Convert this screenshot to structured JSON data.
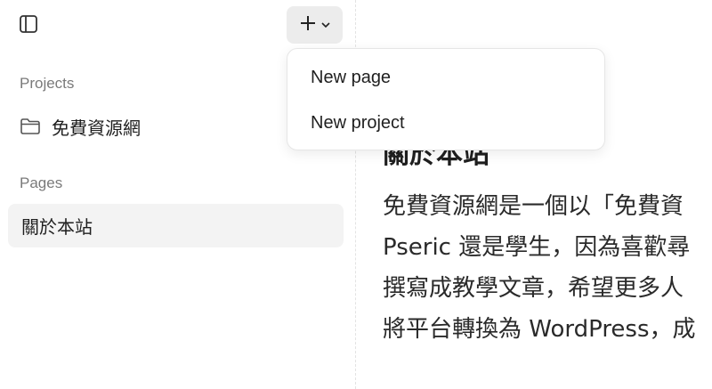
{
  "sidebar": {
    "toggle_icon": "sidebar-toggle-icon",
    "add_icon": "plus-icon",
    "add_chevron_icon": "chevron-down-icon",
    "projects_label": "Projects",
    "projects": [
      {
        "label": "免費資源網",
        "icon": "folder-icon"
      }
    ],
    "pages_label": "Pages",
    "pages": [
      {
        "label": "關於本站",
        "selected": true
      }
    ]
  },
  "dropdown": {
    "items": [
      {
        "label": "New page"
      },
      {
        "label": "New project"
      }
    ]
  },
  "main": {
    "title": "關於本站",
    "paragraph_lines": [
      "免費資源網是一個以「免費資",
      "Pseric 還是學生，因為喜歡尋",
      "撰寫成教學文章，希望更多人",
      "將平台轉換為 WordPress，成"
    ]
  },
  "colors": {
    "add_button_bg": "#ececec",
    "selected_item_bg": "#f3f3f3",
    "section_label": "#7a7a7a",
    "text": "#1f1f1f"
  }
}
